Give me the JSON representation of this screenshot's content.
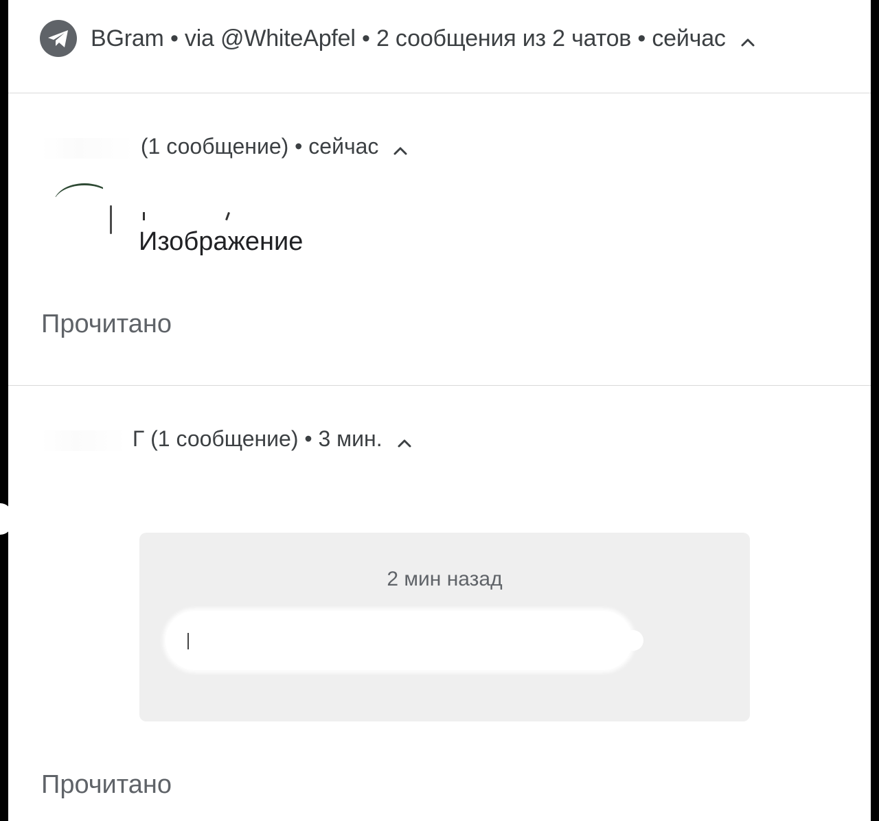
{
  "header": {
    "app_name": "BGram",
    "via": "via @WhiteApfel",
    "summary": "2 сообщения из 2 чатов",
    "time": "сейчас",
    "separator": "•"
  },
  "conversations": [
    {
      "count_label": "(1 сообщение)",
      "time": "сейчас",
      "message": "Изображение",
      "action_label": "Прочитано"
    },
    {
      "count_label": "Г (1 сообщение)",
      "time": "3 мин.",
      "media_time": "2 мин назад",
      "action_label": "Прочитано"
    }
  ],
  "icons": {
    "app": "telegram-plane-icon",
    "expand": "chevron-up-icon"
  },
  "colors": {
    "background": "#ffffff",
    "text": "#3c4043",
    "secondary_text": "#5f6368",
    "icon_bg": "#5f6368",
    "media_card_bg": "#efefef",
    "divider": "#d9d9d9"
  }
}
